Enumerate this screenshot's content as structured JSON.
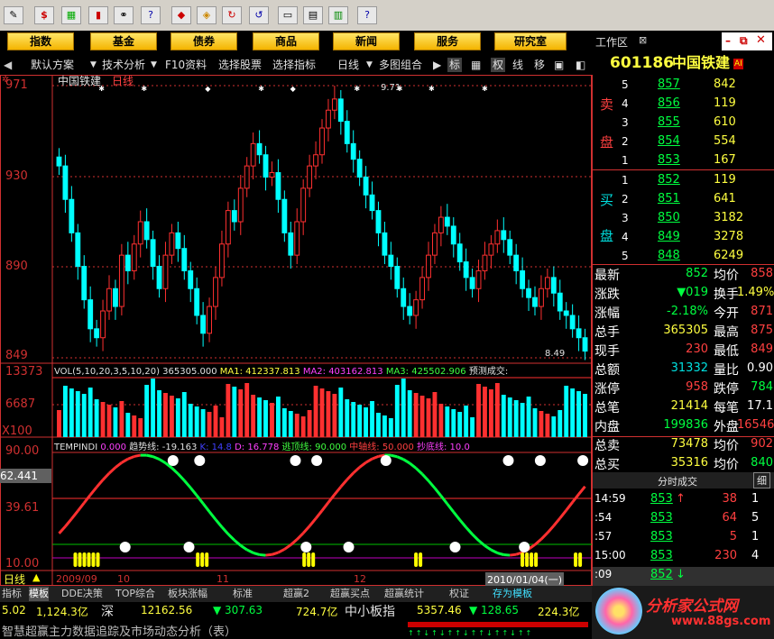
{
  "toolbar": {
    "icons": [
      "pencil-icon",
      "dollar-icon",
      "chart-icon",
      "bar-icon",
      "binoculars-icon",
      "help-icon",
      "diamond-icon",
      "sync-icon",
      "sync2-icon",
      "window-icon",
      "grid-icon",
      "book-icon",
      "help-cursor-icon"
    ],
    "dollar": "$"
  },
  "menu": {
    "items": [
      "指数",
      "基金",
      "债券",
      "商品",
      "新闻",
      "服务",
      "研究室"
    ],
    "workspace": "工作区"
  },
  "tabs": {
    "left": [
      "默认方案",
      "技术分析",
      "F10资料",
      "选择股票",
      "选择指标"
    ],
    "period": "日线",
    "multi": "多图组合",
    "right": [
      "标",
      "权",
      "线",
      "移"
    ]
  },
  "stock": {
    "code": "601186",
    "name": "中国铁建",
    "badge": "AI"
  },
  "chart": {
    "title": "中国铁建",
    "period_label": "日线",
    "price_ticks": [
      "971",
      "930",
      "890",
      "849"
    ],
    "high_label": "9.71",
    "low_label": "8.49",
    "vol_ticks": [
      "13373",
      "6687",
      "X100"
    ],
    "ind_ticks": [
      "90.00",
      "62.441",
      "39.61",
      "10.00"
    ],
    "vol_header": {
      "name": "VOL(5,10,20,3,5,10,20)",
      "vol": "365305.000",
      "ma1": "MA1: 412337.813",
      "ma2": "MA2: 403162.813",
      "ma3": "MA3: 425502.906",
      "pred": "预测成交:"
    },
    "ind_header": {
      "name": "TEMPINDI",
      "val": "0.000",
      "trend": "趋势线: -19.163",
      "k": "K: 14.8",
      "d": "D: 16.778",
      "escape": "逃顶线: 90.000",
      "mid": "中轴线: 50.000",
      "bottom": "抄底线: 10.0"
    },
    "dates": [
      "2009/09",
      "10",
      "11",
      "12",
      "2010/01/04(一)"
    ],
    "period_bottom": "日线"
  },
  "orderbook": {
    "sell_label": [
      "卖",
      "盘"
    ],
    "buy_label": [
      "买",
      "盘"
    ],
    "sell": [
      {
        "lvl": "5",
        "price": "857",
        "vol": "842"
      },
      {
        "lvl": "4",
        "price": "856",
        "vol": "119"
      },
      {
        "lvl": "3",
        "price": "855",
        "vol": "610"
      },
      {
        "lvl": "2",
        "price": "854",
        "vol": "554"
      },
      {
        "lvl": "1",
        "price": "853",
        "vol": "167"
      }
    ],
    "buy": [
      {
        "lvl": "1",
        "price": "852",
        "vol": "119"
      },
      {
        "lvl": "2",
        "price": "851",
        "vol": "641"
      },
      {
        "lvl": "3",
        "price": "850",
        "vol": "3182"
      },
      {
        "lvl": "4",
        "price": "849",
        "vol": "3278"
      },
      {
        "lvl": "5",
        "price": "848",
        "vol": "6249"
      }
    ]
  },
  "quote": [
    {
      "l1": "最新",
      "v1": "852",
      "l2": "均价",
      "v2": "858"
    },
    {
      "l1": "涨跌",
      "v1": "▼019",
      "l2": "换手",
      "v2": "1.49%"
    },
    {
      "l1": "涨幅",
      "v1": "-2.18%",
      "l2": "今开",
      "v2": "871"
    },
    {
      "l1": "总手",
      "v1": "365305",
      "l2": "最高",
      "v2": "875"
    },
    {
      "l1": "现手",
      "v1": "230",
      "l2": "最低",
      "v2": "849"
    },
    {
      "l1": "总额",
      "v1": "31332",
      "l2": "量比",
      "v2": "0.90"
    },
    {
      "l1": "涨停",
      "v1": "958",
      "l2": "跌停",
      "v2": "784"
    },
    {
      "l1": "总笔",
      "v1": "21414",
      "l2": "每笔",
      "v2": "17.1"
    },
    {
      "l1": "内盘",
      "v1": "199836",
      "l2": "外盘",
      "v2": "165469"
    },
    {
      "l1": "总卖",
      "v1": "73478",
      "l2": "均价",
      "v2": "902"
    },
    {
      "l1": "总买",
      "v1": "35316",
      "l2": "均价",
      "v2": "840"
    }
  ],
  "ticks_header": "分时成交",
  "ticks_btn": "细",
  "ticks": [
    {
      "t": "14:59",
      "p": "853",
      "arrow": "↑",
      "v": "38",
      "n": "1"
    },
    {
      "t": ":54",
      "p": "853",
      "arrow": "",
      "v": "64",
      "n": "5"
    },
    {
      "t": ":57",
      "p": "853",
      "arrow": "",
      "v": "5",
      "n": "1"
    },
    {
      "t": "15:00",
      "p": "853",
      "arrow": "",
      "v": "230",
      "n": "4"
    },
    {
      "t": ":09",
      "p": "852",
      "arrow": "↓",
      "v": "",
      "n": ""
    }
  ],
  "bottom_tabs": [
    "指标",
    "模板",
    "DDE决策",
    "TOP综合",
    "板块涨幅",
    "标准",
    "超赢2",
    "超赢买点",
    "超赢统计",
    "权证",
    "存为模板"
  ],
  "status": {
    "v1": "5.02",
    "v2": "1,124.3亿",
    "mkt": "深",
    "v3": "12162.56",
    "v4": "▼ 307.63",
    "v5": "724.7亿",
    "idx": "中小板指",
    "v6": "5357.46",
    "v7": "▼ 128.65",
    "v8": "224.3亿"
  },
  "marquee": "智慧超赢主力数据追踪及市场动态分析（表）",
  "brand": {
    "name": "分析家公式网",
    "url": "www.88gs.com"
  },
  "colors": {
    "up": "#ff3030",
    "down": "#00ffff",
    "axis": "#d03030",
    "yellow": "#ffff00"
  }
}
